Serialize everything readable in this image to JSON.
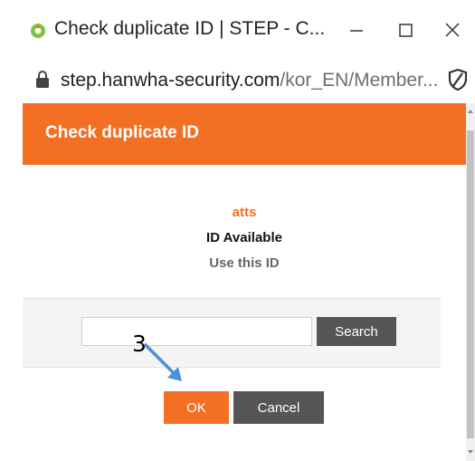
{
  "window": {
    "title": "Check duplicate ID | STEP - C...",
    "minimize_icon": "minimize-icon",
    "maximize_icon": "maximize-icon",
    "close_icon": "close-icon"
  },
  "address": {
    "url_domain": "step.hanwha-security.com",
    "url_path": "/kor_EN/Member..."
  },
  "dialog": {
    "title": "Check duplicate ID",
    "result_id": "atts",
    "result_status": "ID Available",
    "result_hint": "Use this ID",
    "search_value": "",
    "search_placeholder": "",
    "search_label": "Search",
    "ok_label": "OK",
    "cancel_label": "Cancel"
  },
  "annotation": {
    "step_number": "3"
  },
  "colors": {
    "accent": "#f26f23",
    "button_dark": "#555555"
  }
}
